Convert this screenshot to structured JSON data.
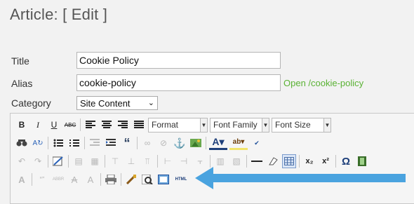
{
  "header": {
    "title": "Article: [ Edit ]"
  },
  "form": {
    "title_label": "Title",
    "title_value": "Cookie Policy",
    "alias_label": "Alias",
    "alias_value": "cookie-policy",
    "alias_link": "Open /cookie-policy",
    "category_label": "Category",
    "category_value": "Site Content"
  },
  "toolbar": {
    "format_label": "Format",
    "font_family_label": "Font Family",
    "font_size_label": "Font Size",
    "bold": "B",
    "italic": "I",
    "underline": "U",
    "strike": "ABC",
    "quote": "“",
    "subscript": "x₂",
    "superscript": "x²",
    "omega": "Ω",
    "html": "HTML",
    "abbr": "ABBR",
    "quote_mark": "“”"
  },
  "colors": {
    "link": "#5ab234",
    "arrow": "#4aa3df"
  }
}
